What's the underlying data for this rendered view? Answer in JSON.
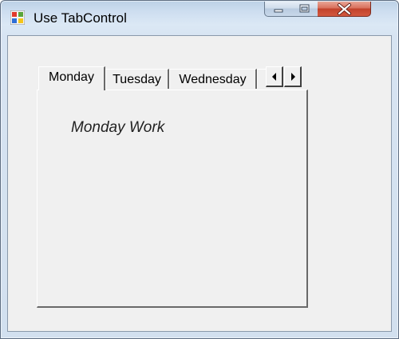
{
  "window": {
    "title": "Use TabControl",
    "icon": "windows-forms-app-icon",
    "controls": {
      "minimize_icon": "minimize-icon",
      "maximize_icon": "maximize-icon",
      "close_icon": "close-icon"
    }
  },
  "tab_control": {
    "tabs": [
      {
        "label": "Monday",
        "selected": true
      },
      {
        "label": "Tuesday",
        "selected": false
      },
      {
        "label": "Wednesday",
        "selected": false
      }
    ],
    "scroll_left_icon": "arrow-left-icon",
    "scroll_right_icon": "arrow-right-icon",
    "active_page": {
      "text": "Monday Work"
    }
  },
  "colors": {
    "frame": "#d2e0ef",
    "client": "#f0f0f0",
    "close_button": "#c2422b"
  }
}
